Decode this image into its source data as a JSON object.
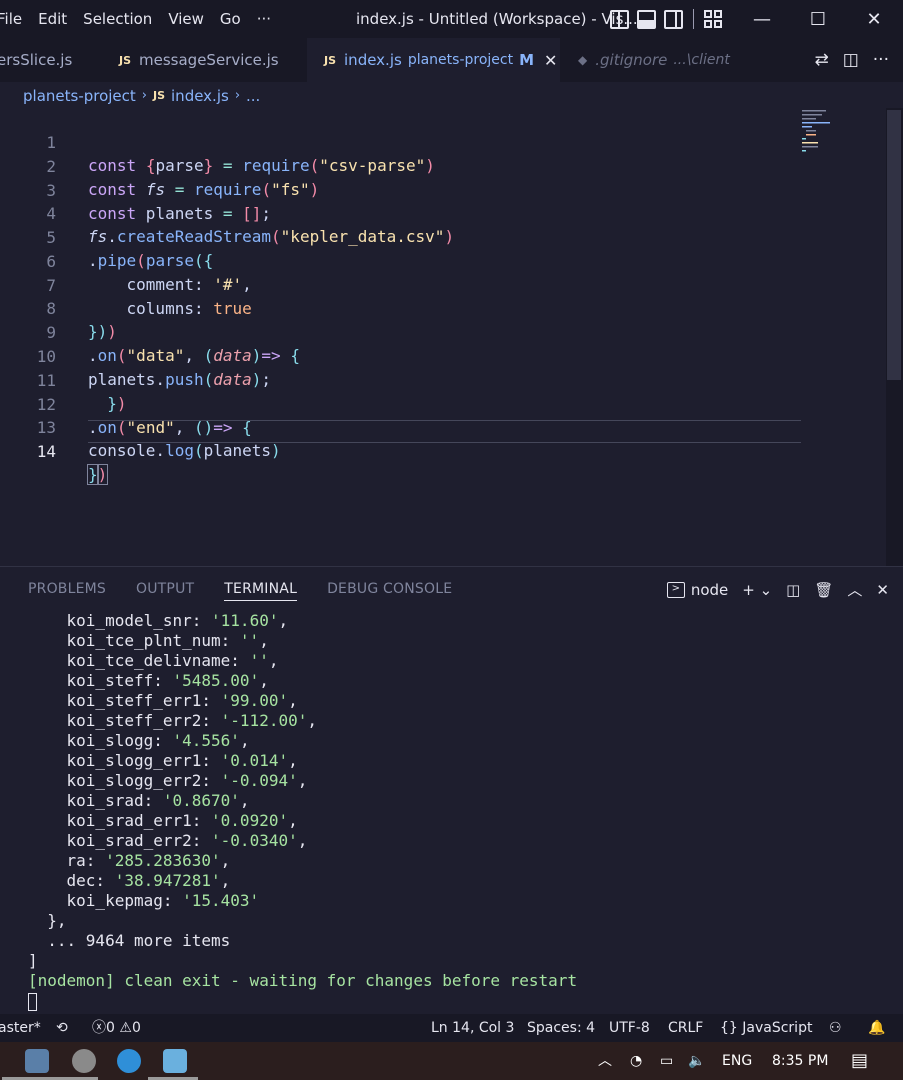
{
  "menu": [
    "File",
    "Edit",
    "Selection",
    "View",
    "Go",
    "···"
  ],
  "window_title": "index.js - Untitled (Workspace) - Vis...",
  "window_controls": {
    "minimize": "—",
    "maximize": "☐",
    "close": "✕"
  },
  "tabs": [
    {
      "name": "ersSlice.js"
    },
    {
      "icon": "JS",
      "name": "messageService.js"
    },
    {
      "icon": "JS",
      "name": "index.js",
      "desc": "planets-project",
      "status": "M",
      "close": "✕"
    },
    {
      "icon": "◆",
      "name": ".gitignore",
      "desc": "...\\client"
    }
  ],
  "breadcrumb": {
    "folder": "planets-project",
    "icon": "JS",
    "file": "index.js",
    "more": "..."
  },
  "editor": {
    "line_numbers": [
      "1",
      "2",
      "3",
      "4",
      "5",
      "6",
      "7",
      "8",
      "9",
      "10",
      "11",
      "12",
      "13",
      "14"
    ],
    "current_line": 14
  },
  "panel": {
    "tabs": [
      "PROBLEMS",
      "OUTPUT",
      "TERMINAL",
      "DEBUG CONSOLE"
    ],
    "active_tab": "TERMINAL",
    "shell": "node",
    "terminal_lines": [
      {
        "key": "    koi_model_snr: ",
        "val": "'11.60'",
        "end": ","
      },
      {
        "key": "    koi_tce_plnt_num: ",
        "val": "''",
        "end": ","
      },
      {
        "key": "    koi_tce_delivname: ",
        "val": "''",
        "end": ","
      },
      {
        "key": "    koi_steff: ",
        "val": "'5485.00'",
        "end": ","
      },
      {
        "key": "    koi_steff_err1: ",
        "val": "'99.00'",
        "end": ","
      },
      {
        "key": "    koi_steff_err2: ",
        "val": "'-112.00'",
        "end": ","
      },
      {
        "key": "    koi_slogg: ",
        "val": "'4.556'",
        "end": ","
      },
      {
        "key": "    koi_slogg_err1: ",
        "val": "'0.014'",
        "end": ","
      },
      {
        "key": "    koi_slogg_err2: ",
        "val": "'-0.094'",
        "end": ","
      },
      {
        "key": "    koi_srad: ",
        "val": "'0.8670'",
        "end": ","
      },
      {
        "key": "    koi_srad_err1: ",
        "val": "'0.0920'",
        "end": ","
      },
      {
        "key": "    koi_srad_err2: ",
        "val": "'-0.0340'",
        "end": ","
      },
      {
        "key": "    ra: ",
        "val": "'285.283630'",
        "end": ","
      },
      {
        "key": "    dec: ",
        "val": "'38.947281'",
        "end": ","
      },
      {
        "key": "    koi_kepmag: ",
        "val": "'15.403'",
        "end": ""
      }
    ],
    "after_lines": [
      "  },",
      "  ... 9464 more items",
      "]"
    ],
    "nodemon_line": "[nodemon] clean exit - waiting for changes before restart"
  },
  "statusbar": {
    "branch": "aster*",
    "errors": "0",
    "warnings": "0",
    "position": "Ln 14, Col 3",
    "spaces": "Spaces: 4",
    "encoding": "UTF-8",
    "eol": "CRLF",
    "language": "JavaScript"
  },
  "taskbar": {
    "language": "ENG",
    "time": "8:35 PM"
  },
  "colors": {
    "accent": "#89b4fa",
    "background": "#1e1e2e",
    "terminal_string": "#a6e3a1"
  }
}
